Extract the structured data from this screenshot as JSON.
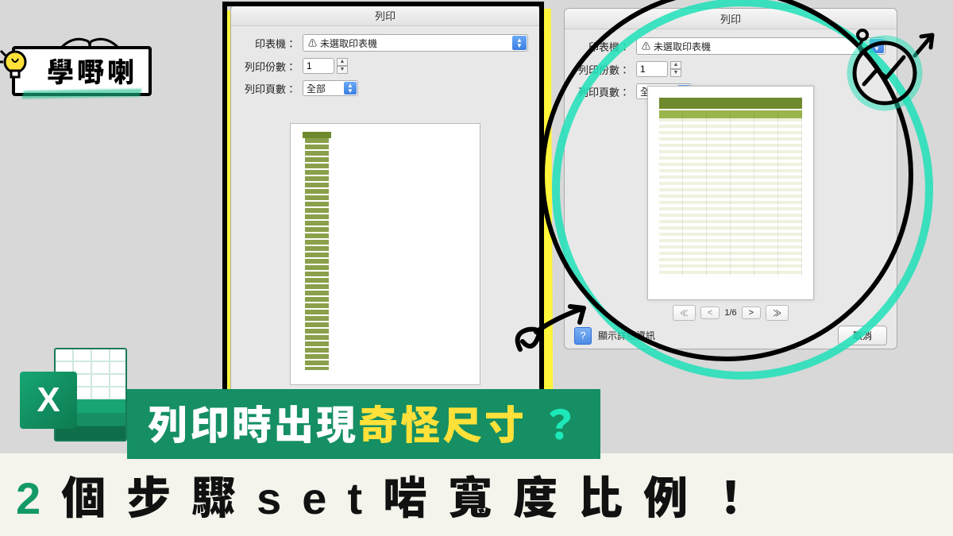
{
  "sticker": {
    "text": "學嘢喇"
  },
  "dialog_left": {
    "title": "列印",
    "printer_label": "印表機：",
    "printer_value": "未選取印表機",
    "copies_label": "列印份數：",
    "copies_value": "1",
    "pages_label": "列印頁數：",
    "pages_value": "全部"
  },
  "dialog_right": {
    "title": "列印",
    "printer_label": "印表機：",
    "printer_value": "未選取印表機",
    "copies_label": "列印份數：",
    "copies_value": "1",
    "pages_label": "列印頁數：",
    "pages_value": "全部",
    "pager_text": "1/6",
    "details_link": "顯示詳細資訊",
    "cancel": "取消"
  },
  "excel": {
    "letter": "X"
  },
  "headline1_a": "列印時出現",
  "headline1_b": "奇怪尺寸",
  "headline1_q": "？",
  "headline2_prefix": "2",
  "headline2_rest": "個步驟set啱寬度比例！"
}
